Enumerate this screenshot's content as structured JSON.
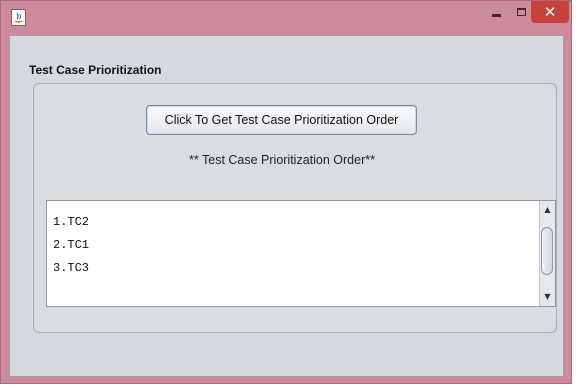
{
  "window": {
    "icon": "java-icon",
    "controls": {
      "minimize_icon": "minimize-icon",
      "maximize_icon": "maximize-icon",
      "close_glyph": "✕"
    }
  },
  "panel": {
    "title": "Test Case Prioritization"
  },
  "action_button": {
    "label": "Click To Get Test Case Prioritization Order"
  },
  "order_heading": "** Test Case Prioritization Order**",
  "result_list": {
    "items": [
      "1.TC2",
      "2.TC1",
      "3.TC3"
    ],
    "scroll_up_glyph": "▲",
    "scroll_down_glyph": "▼"
  },
  "colors": {
    "titlebar": "#cc8a9a",
    "close_button": "#c7423a",
    "panel_bg": "#d6d9df"
  }
}
